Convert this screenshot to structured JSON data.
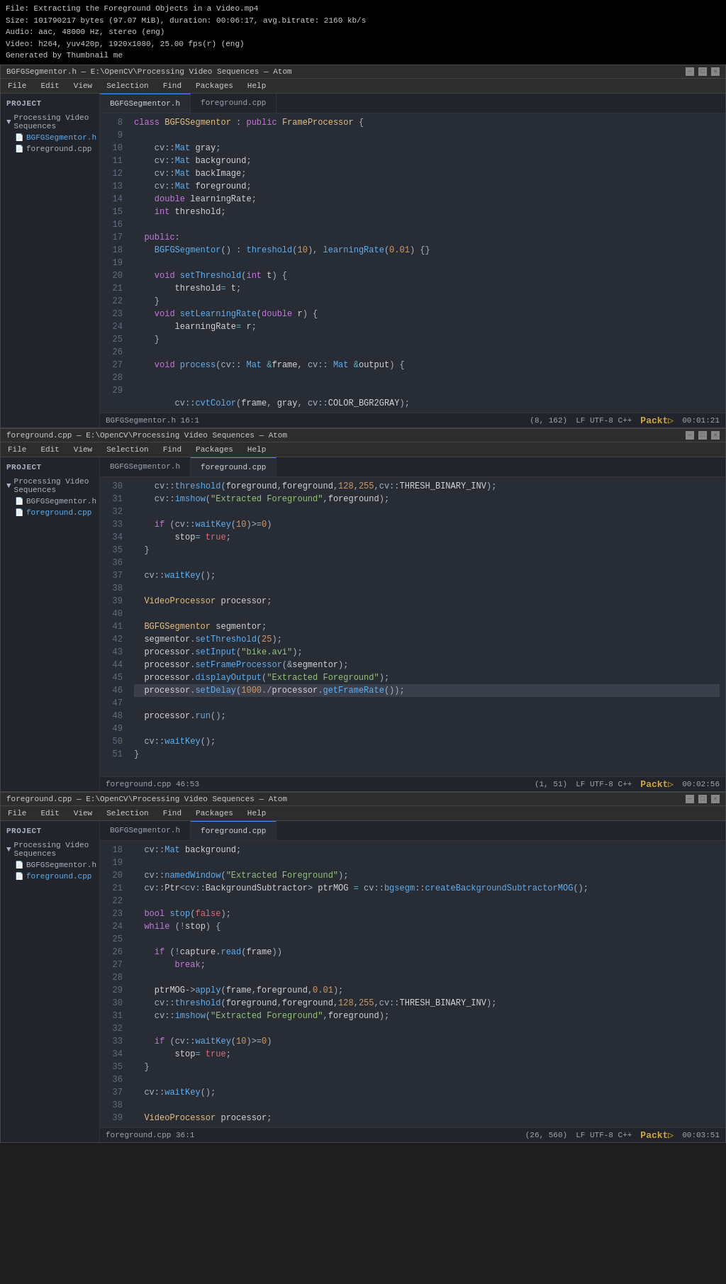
{
  "video": {
    "line1": "File: Extracting the Foreground Objects in a Video.mp4",
    "line2": "Size: 101790217 bytes (97.07 MiB), duration: 00:06:17, avg.bitrate: 2160 kb/s",
    "line3": "Audio: aac, 48000 Hz, stereo (eng)",
    "line4": "Video: h264, yuv420p, 1920x1080, 25.00 fps(r) (eng)",
    "line5": "Generated by Thumbnail me"
  },
  "window1": {
    "title": "BGFGSegmentor.h — E:\\OpenCV\\Processing Video Sequences — Atom",
    "menu": [
      "File",
      "Edit",
      "View",
      "Selection",
      "Find",
      "Packages",
      "Help"
    ],
    "tab_active": "BGFGSegmentor.h",
    "tab_inactive": "foreground.cpp",
    "sidebar_title": "Project",
    "sidebar_group": "Processing Video Sequences",
    "sidebar_file1": "BGFGSegmentor.h",
    "sidebar_file2": "foreground.cpp",
    "status_left": "BGFGSegmentor.h  16:1",
    "status_pos": "(8, 162)",
    "status_encoding": "LF  UTF-8  C++",
    "status_timer": "00:01:21",
    "packt": "Packt▷"
  },
  "window2": {
    "title": "foreground.cpp — E:\\OpenCV\\Processing Video Sequences — Atom",
    "tab_active": "foreground.cpp",
    "tab_inactive": "BGFGSegmentor.h",
    "sidebar_file1": "BGFGSegmentor.h",
    "sidebar_file2": "foreground.cpp",
    "status_left": "foreground.cpp  46:53",
    "status_pos": "(1, 51)",
    "status_encoding": "LF  UTF-8  C++",
    "status_timer": "00:02:56",
    "packt": "Packt▷"
  },
  "window3": {
    "title": "foreground.cpp — E:\\OpenCV\\Processing Video Sequences — Atom",
    "tab_active": "foreground.cpp",
    "tab_inactive": "BGFGSegmentor.h",
    "sidebar_file1": "BGFGSegmentor.h",
    "sidebar_file2": "foreground.cpp",
    "status_left": "foreground.cpp  36:1",
    "status_pos": "(26, 560)",
    "status_encoding": "LF  UTF-8  C++",
    "status_timer": "00:03:51",
    "packt": "Packt▷"
  },
  "colors": {
    "bg": "#282c34",
    "sidebar_bg": "#21252b",
    "accent": "#528bff",
    "keyword": "#c678dd",
    "type": "#61afef",
    "string": "#98c379",
    "number": "#d19a66"
  }
}
